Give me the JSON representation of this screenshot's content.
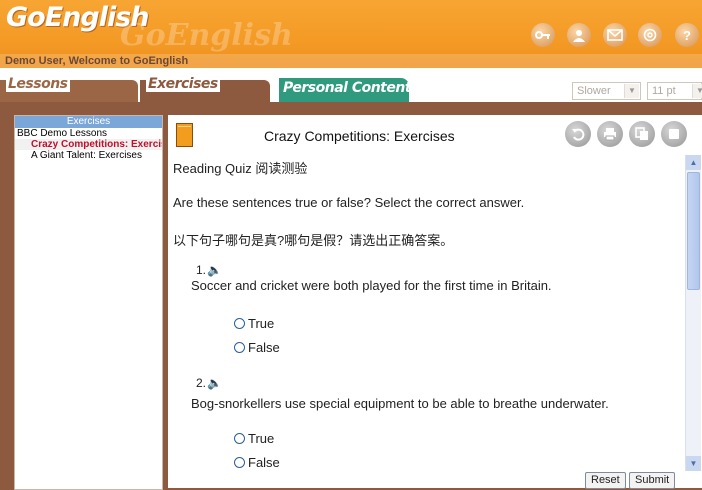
{
  "header": {
    "logo": "GoEnglish",
    "watermark": "GoEnglish",
    "welcome": "Demo User, Welcome to GoEnglish",
    "icons": [
      "key-icon",
      "user-icon",
      "mail-icon",
      "at-icon",
      "help-icon"
    ],
    "help_glyph": "?"
  },
  "tabs": {
    "lessons": "Lessons",
    "exercises": "Exercises",
    "personal": "Personal Content"
  },
  "controls": {
    "speed": "Slower",
    "font_size": "11 pt"
  },
  "sidebar": {
    "title": "Exercises",
    "root": "BBC Demo Lessons",
    "items": [
      "Crazy Competitions: Exercises",
      "A Giant Talent: Exercises"
    ]
  },
  "content": {
    "title": "Crazy Competitions: Exercises",
    "quiz_label": "Reading Quiz 阅读测验",
    "instruction_en": "Are these sentences true or false? Select the correct answer.",
    "instruction_zh": "以下句子哪句是真?哪句是假？请选出正确答案。",
    "speaker_glyph": "🔈",
    "questions": [
      {
        "number": "1.",
        "text": "Soccer and cricket were both played for the first time in Britain.",
        "options": [
          "True",
          "False"
        ]
      },
      {
        "number": "2.",
        "text": "Bog-snorkellers use special equipment to be able to breathe underwater.",
        "options": [
          "True",
          "False"
        ]
      }
    ]
  },
  "buttons": {
    "reset": "Reset",
    "submit": "Submit"
  },
  "colors": {
    "header_orange": "#f49a25",
    "frame_brown": "#8e5a3f",
    "personal_tab_teal": "#2f9a7e",
    "selected_item_red": "#c0102a",
    "sidebar_title_blue": "#7aa6d8"
  }
}
